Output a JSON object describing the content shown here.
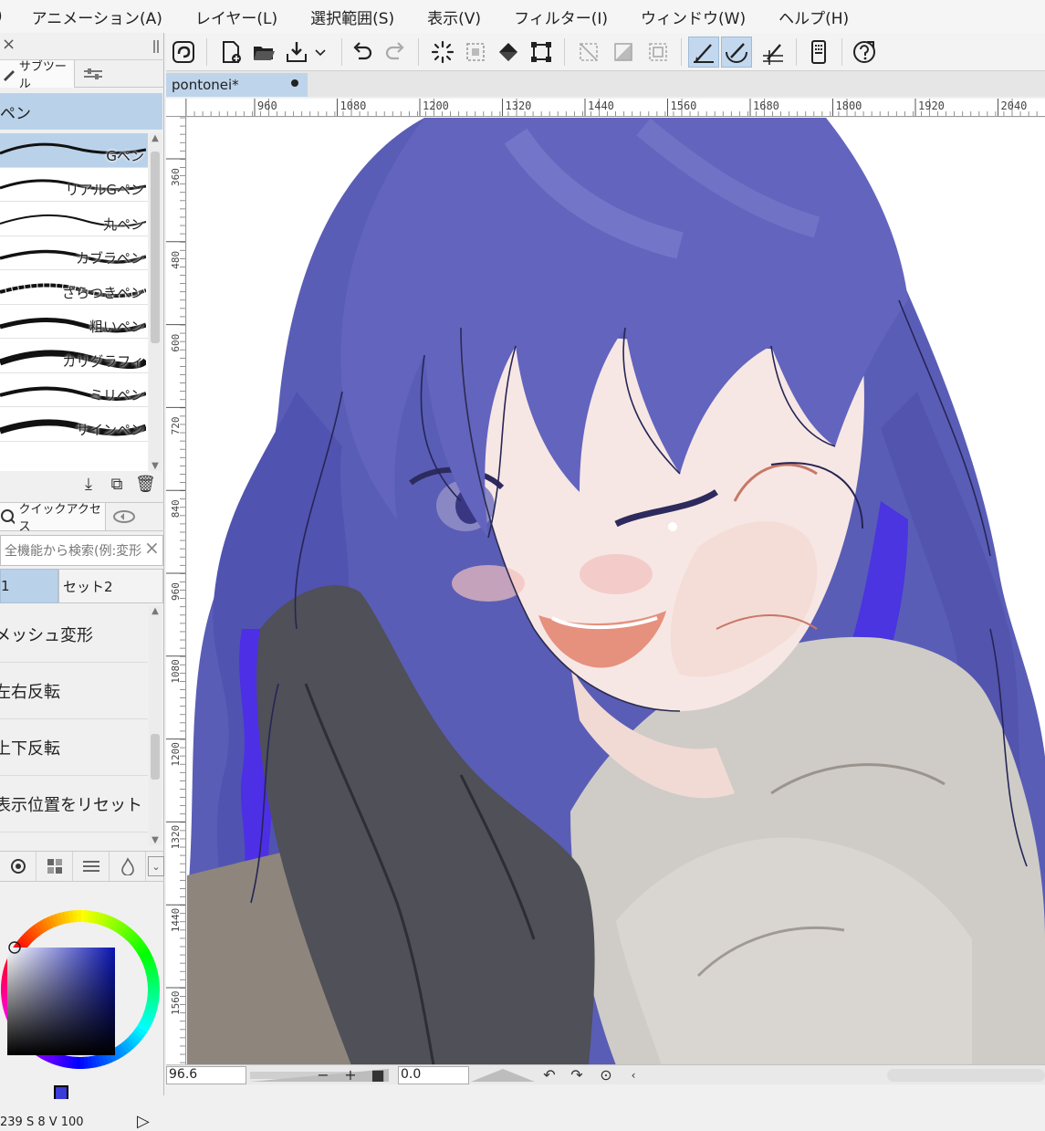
{
  "menu": [
    "アニメーション(A)",
    "レイヤー(L)",
    "選択範囲(S)",
    "表示(V)",
    "フィルター(I)",
    "ウィンドウ(W)",
    "ヘルプ(H)"
  ],
  "subtool": {
    "tab_label": "サブツール",
    "group_title": "ペン",
    "brushes": [
      "Gペン",
      "リアルGペン",
      "丸ペン",
      "カブラペン",
      "ざらつきペン",
      "粗いペン",
      "カリグラフィ",
      "ミリペン",
      "サインペン"
    ],
    "selected_index": 0
  },
  "quick_access": {
    "tab_label": "クイックアクセス",
    "search_placeholder": "全機能から検索(例:変形",
    "sets": [
      "1",
      "セット2"
    ],
    "items": [
      "メッシュ変形",
      "左右反転",
      "上下反転",
      "表示位置をリセット"
    ]
  },
  "color": {
    "current_hex": "#0a1aa0",
    "hsv_text": "239 S 8 V 100"
  },
  "document": {
    "tab_title": "pontonei*"
  },
  "ruler": {
    "top_labels": [
      "960",
      "1080",
      "1200",
      "1320",
      "1440",
      "1560",
      "1680",
      "1800",
      "1920",
      "2040"
    ],
    "left_labels": [
      "360",
      "480",
      "600",
      "720",
      "840",
      "960",
      "1080",
      "1200",
      "1320",
      "1440",
      "1560"
    ]
  },
  "status": {
    "zoom": "96.6",
    "rotation": "0.0"
  },
  "icons": {
    "toolbar": [
      "companion-icon",
      "new-file-icon",
      "open-folder-icon",
      "save-icon",
      "dropdown-icon",
      "undo-icon",
      "redo-icon",
      "loading-icon",
      "select-all-icon",
      "fill-icon",
      "transform-icon",
      "clear-icon",
      "clear-out-icon",
      "deselect-icon",
      "snap-ruler-icon",
      "snap-special-icon",
      "snap-grid-icon",
      "device-icon",
      "help-icon"
    ]
  },
  "colors": {
    "accent": "#b9d2ea",
    "hair": "#5657b3",
    "hair_highlight": "#4f3de0",
    "skin": "#f6e6e3",
    "coat": "#cdcac4",
    "jacket": "#4e4f56"
  }
}
